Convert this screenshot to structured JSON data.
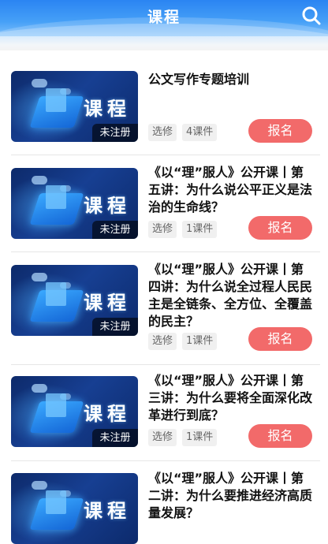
{
  "header": {
    "title": "课程"
  },
  "courses": [
    {
      "thumb_label": "课程",
      "status": "未注册",
      "title": "公文写作专题培训",
      "type_tag": "选修",
      "count_tag": "4课件",
      "button": "报名"
    },
    {
      "thumb_label": "课程",
      "status": "未注册",
      "title": "《以“理”服人》公开课丨第五讲：为什么说公平正义是法治的生命线？",
      "type_tag": "选修",
      "count_tag": "1课件",
      "button": "报名"
    },
    {
      "thumb_label": "课程",
      "status": "未注册",
      "title": "《以“理”服人》公开课丨第四讲：为什么说全过程人民民主是全链条、全方位、全覆盖的民主？",
      "type_tag": "选修",
      "count_tag": "1课件",
      "button": "报名"
    },
    {
      "thumb_label": "课程",
      "status": "未注册",
      "title": "《以“理”服人》公开课丨第三讲：为什么要将全面深化改革进行到底？",
      "type_tag": "选修",
      "count_tag": "1课件",
      "button": "报名"
    },
    {
      "thumb_label": "课程",
      "title": "《以“理”服人》公开课丨第二讲：为什么要推进经济高质量发展？"
    }
  ]
}
